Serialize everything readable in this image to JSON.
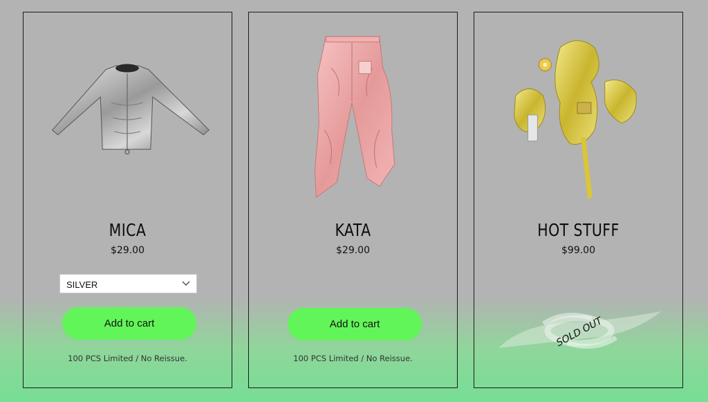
{
  "colors": {
    "background": "#b3b3b3",
    "button": "#62f559",
    "border": "#1a1a1a"
  },
  "products": [
    {
      "name": "MICA",
      "price": "$29.00",
      "variant_select": {
        "selected": "SILVER"
      },
      "add_to_cart_label": "Add to cart",
      "note": "100 PCS Limited / No Reissue.",
      "image_icon": "silver-jacket-image"
    },
    {
      "name": "KATA",
      "price": "$29.00",
      "add_to_cart_label": "Add to cart",
      "note": "100 PCS Limited / No Reissue.",
      "image_icon": "pink-pants-image"
    },
    {
      "name": "HOT STUFF",
      "price": "$99.00",
      "status_badge": "SOLD OUT",
      "image_icon": "gold-accessories-image"
    }
  ]
}
